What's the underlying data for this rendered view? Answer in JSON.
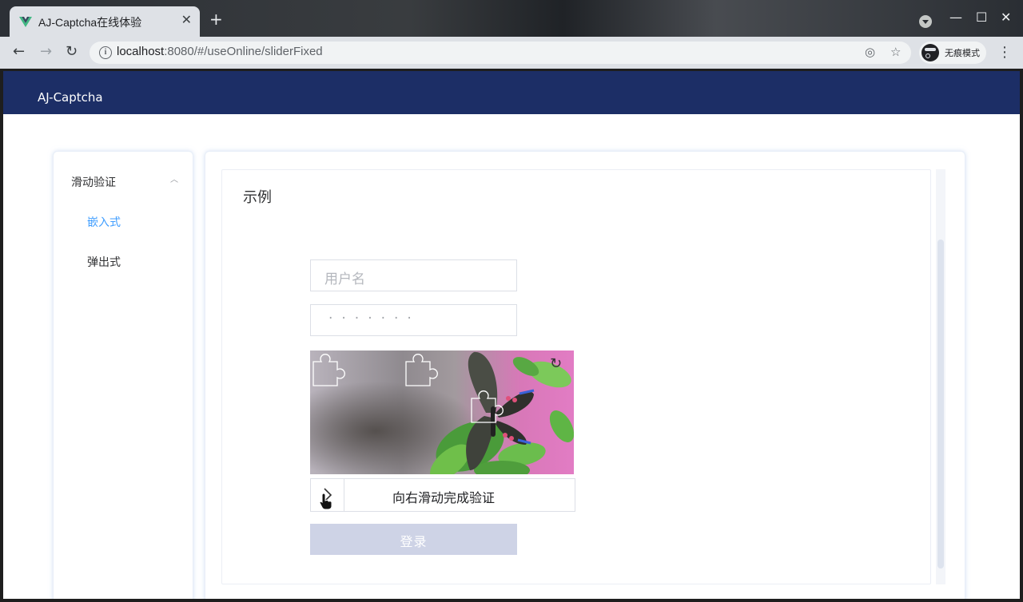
{
  "browser": {
    "tab_title": "AJ-Captcha在线体验",
    "url_host": "localhost",
    "url_rest": ":8080/#/useOnline/sliderFixed",
    "incognito_label": "无痕模式"
  },
  "app": {
    "title": "AJ-Captcha"
  },
  "sidebar": {
    "group_label": "滑动验证",
    "items": [
      {
        "label": "嵌入式",
        "active": true
      },
      {
        "label": "弹出式",
        "active": false
      }
    ]
  },
  "main": {
    "card_title": "示例",
    "username_placeholder": "用户名",
    "password_mask": "·······",
    "slider_hint": "向右滑动完成验证",
    "login_label": "登录"
  },
  "colors": {
    "header_bg": "#1c2e66",
    "active_menu": "#409eff",
    "login_disabled": "#ced3e6"
  }
}
